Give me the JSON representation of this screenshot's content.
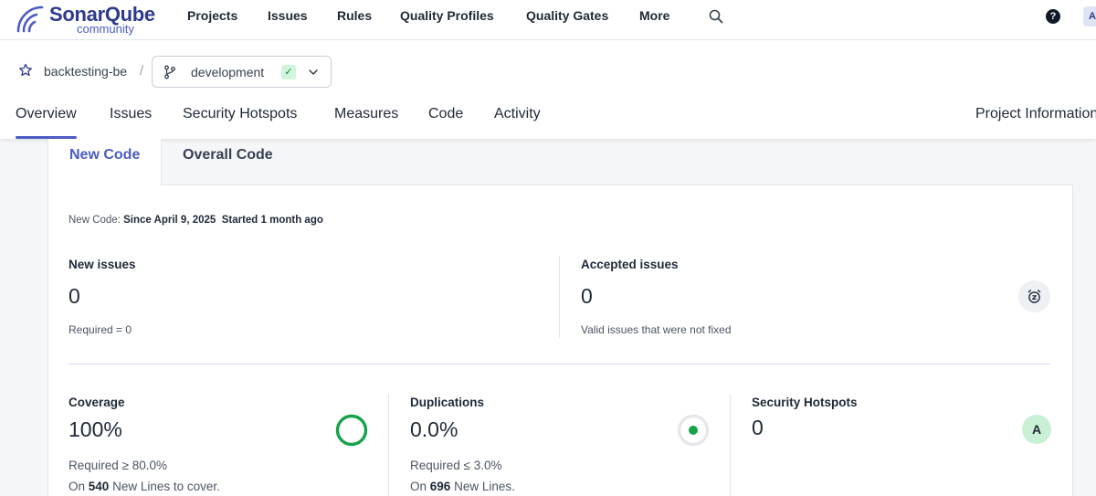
{
  "brand": {
    "name": "SonarQube",
    "edition": "community"
  },
  "nav": {
    "items": [
      {
        "label": "Projects"
      },
      {
        "label": "Issues"
      },
      {
        "label": "Rules"
      },
      {
        "label": "Quality Profiles"
      },
      {
        "label": "Quality Gates"
      },
      {
        "label": "More"
      }
    ],
    "help_label": "?",
    "avatar_initial": "A"
  },
  "project": {
    "name": "backtesting-be",
    "separator": "/",
    "branch": "development",
    "branch_status_icon": "check-icon"
  },
  "tabs": {
    "overview": "Overview",
    "issues": "Issues",
    "security_hotspots": "Security Hotspots",
    "measures": "Measures",
    "code": "Code",
    "activity": "Activity",
    "project_information": "Project Information"
  },
  "subtabs": {
    "new_code": "New Code",
    "overall_code": "Overall Code"
  },
  "new_code_period": {
    "label": "New Code:",
    "since": "Since April 9, 2025",
    "started": "Started 1 month ago"
  },
  "metrics": {
    "new_issues": {
      "title": "New issues",
      "value": "0",
      "note": "Required = 0"
    },
    "accepted_issues": {
      "title": "Accepted issues",
      "value": "0",
      "note": "Valid issues that were not fixed"
    },
    "coverage": {
      "title": "Coverage",
      "value": "100%",
      "fraction": 1.0,
      "required": "Required ≥ 80.0%",
      "lines_prefix": "On",
      "lines_count": "540",
      "lines_suffix": "New Lines to cover."
    },
    "duplications": {
      "title": "Duplications",
      "value": "0.0%",
      "fraction": 0.0,
      "required": "Required ≤ 3.0%",
      "lines_prefix": "On",
      "lines_count": "696",
      "lines_suffix": "New Lines."
    },
    "security_hotspots": {
      "title": "Security Hotspots",
      "value": "0",
      "rating": "A"
    }
  },
  "colors": {
    "accent": "#4b5bc4",
    "brand": "#2d3a8c",
    "good": "#16a34a",
    "rating_a_bg": "#c9f0d4"
  }
}
